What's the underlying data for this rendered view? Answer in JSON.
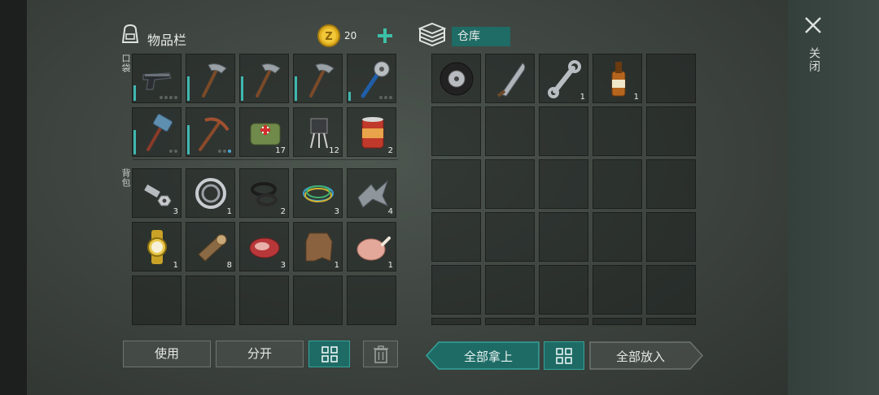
{
  "inventory": {
    "title": "物品栏",
    "coins": "20",
    "pocket_label": "口袋",
    "backpack_label": "背包",
    "pocket": [
      {
        "icon": "pistol-icon",
        "count": "",
        "durability": 0.35,
        "dots": [
          0,
          0,
          0,
          0
        ]
      },
      {
        "icon": "hatchet-icon",
        "count": "",
        "durability": 0.55,
        "dots": []
      },
      {
        "icon": "hatchet-icon",
        "count": "",
        "durability": 0.55,
        "dots": []
      },
      {
        "icon": "hatchet-icon",
        "count": "",
        "durability": 0.55,
        "dots": []
      },
      {
        "icon": "spiked-club-icon",
        "count": "",
        "durability": 0.2,
        "dots": [
          0,
          0,
          0
        ]
      },
      {
        "icon": "sledgehammer-icon",
        "count": "",
        "durability": 0.55,
        "dots": [
          0,
          0
        ]
      },
      {
        "icon": "pickaxe-icon",
        "count": "",
        "durability": 0.65,
        "dots": [
          0,
          0,
          1
        ]
      },
      {
        "icon": "medkit-bag-icon",
        "count": "17",
        "durability": 0,
        "dots": []
      },
      {
        "icon": "transistor-icon",
        "count": "12",
        "durability": 0,
        "dots": []
      },
      {
        "icon": "canned-food-icon",
        "count": "2",
        "durability": 0,
        "dots": []
      }
    ],
    "backpack": [
      {
        "icon": "bolt-nut-icon",
        "count": "3"
      },
      {
        "icon": "bearing-icon",
        "count": "1"
      },
      {
        "icon": "rubber-rings-icon",
        "count": "2"
      },
      {
        "icon": "wires-icon",
        "count": "3"
      },
      {
        "icon": "scrap-metal-icon",
        "count": "4"
      },
      {
        "icon": "wristwatch-icon",
        "count": "1"
      },
      {
        "icon": "log-icon",
        "count": "8"
      },
      {
        "icon": "raw-meat-icon",
        "count": "3"
      },
      {
        "icon": "leather-icon",
        "count": "1"
      },
      {
        "icon": "raw-chicken-icon",
        "count": "1"
      },
      {
        "icon": "",
        "count": ""
      },
      {
        "icon": "",
        "count": ""
      },
      {
        "icon": "",
        "count": ""
      },
      {
        "icon": "",
        "count": ""
      },
      {
        "icon": "",
        "count": ""
      }
    ],
    "buttons": {
      "use": "使用",
      "split": "分开"
    }
  },
  "storage": {
    "title": "仓库",
    "items": [
      {
        "icon": "tire-icon",
        "count": ""
      },
      {
        "icon": "machete-icon",
        "count": ""
      },
      {
        "icon": "wrench-icon",
        "count": "1"
      },
      {
        "icon": "whiskey-bottle-icon",
        "count": "1"
      }
    ],
    "buttons": {
      "take_all": "全部拿上",
      "put_all": "全部放入"
    }
  },
  "close_label": "关闭",
  "colors": {
    "accent": "#1f6b65",
    "accent_border": "#35a29a",
    "durability": "#3fb8b0",
    "coin": "#e0b020"
  }
}
